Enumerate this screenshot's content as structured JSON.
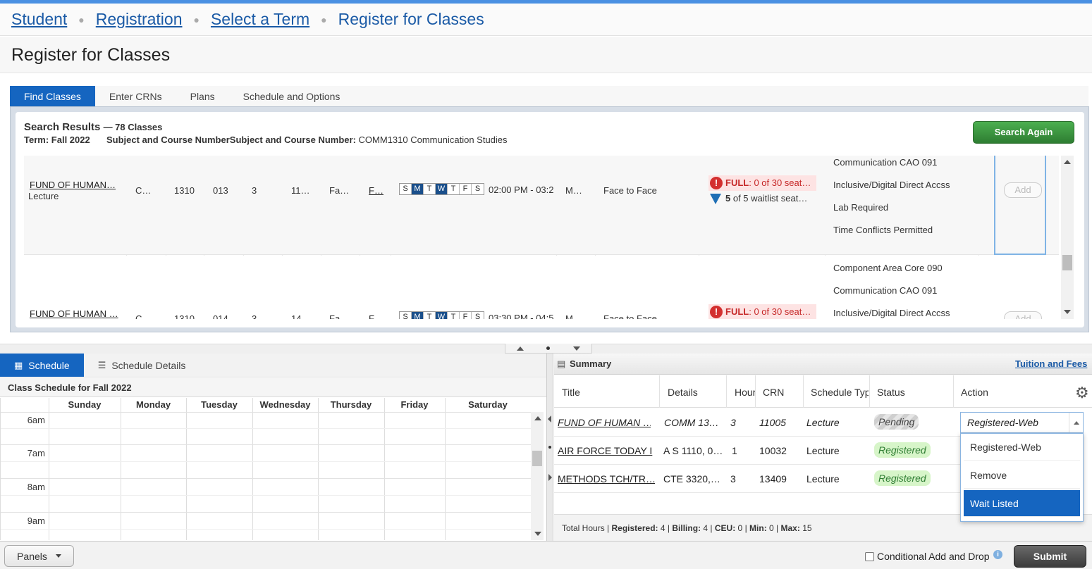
{
  "breadcrumb": {
    "items": [
      "Student",
      "Registration",
      "Select a Term"
    ],
    "current": "Register for Classes"
  },
  "page_title": "Register for Classes",
  "tabs": [
    {
      "label": "Find Classes",
      "active": true
    },
    {
      "label": "Enter CRNs",
      "active": false
    },
    {
      "label": "Plans",
      "active": false
    },
    {
      "label": "Schedule and Options",
      "active": false
    }
  ],
  "search": {
    "heading": "Search Results",
    "count_text": "— 78 Classes",
    "term_label": "Term:",
    "term_value": "Fall 2022",
    "subject_label_dup": "Subject and Course Number",
    "subject_label": "Subject and Course Number:",
    "subject_value": "COMM1310 Communication Studies",
    "search_again_label": "Search Again"
  },
  "results": [
    {
      "title": "FUND OF HUMAN…",
      "schedule_type": "Lecture",
      "subject": "C…",
      "course": "1310",
      "section": "013",
      "hours": "3",
      "crn": "11…",
      "term": "Fa…",
      "instructor": "F…",
      "days": [
        "S",
        "M",
        "T",
        "W",
        "T",
        "F",
        "S"
      ],
      "time": "02:00 PM - 03:2",
      "campus": "M…",
      "method": "Face to Face",
      "status_full": "FULL",
      "status_seats": ": 0 of 30 seat…",
      "status_waitlist_count": "5",
      "status_waitlist": " of 5 waitlist seat…",
      "attributes": [
        "Communication CAO 091",
        "Inclusive/Digital Direct Accss",
        "Lab Required",
        "Time Conflicts Permitted"
      ],
      "add_label": "Add"
    },
    {
      "title": "FUND OF HUMAN …",
      "subject": "C…",
      "course": "1310",
      "section": "014",
      "hours": "3",
      "crn": "14…",
      "term": "Fa…",
      "instructor": "F…",
      "days": [
        "S",
        "M",
        "T",
        "W",
        "T",
        "F",
        "S"
      ],
      "time": "03:30 PM - 04:5",
      "campus": "M…",
      "method": "Face to Face",
      "status_full": "FULL",
      "status_seats": ": 0 of 30 seat…",
      "attributes": [
        "Component Area Core 090",
        "Communication CAO 091",
        "Inclusive/Digital Direct Accss"
      ],
      "add_label": "Add"
    }
  ],
  "schedule": {
    "tab_schedule": "Schedule",
    "tab_details": "Schedule Details",
    "title": "Class Schedule for Fall 2022",
    "days": [
      "Sunday",
      "Monday",
      "Tuesday",
      "Wednesday",
      "Thursday",
      "Friday",
      "Saturday"
    ],
    "times": [
      "6am",
      "7am",
      "8am",
      "9am"
    ]
  },
  "summary": {
    "title": "Summary",
    "tuition_link": "Tuition and Fees",
    "columns": [
      "Title",
      "Details",
      "Hour",
      "CRN",
      "Schedule Typ",
      "Status",
      "Action"
    ],
    "rows": [
      {
        "title": "FUND OF HUMAN …",
        "details": "COMM 13…",
        "hours": "3",
        "crn": "11005",
        "type": "Lecture",
        "status": "Pending"
      },
      {
        "title": "AIR FORCE TODAY I",
        "details": "A S 1110, 0…",
        "hours": "1",
        "crn": "10032",
        "type": "Lecture",
        "status": "Registered"
      },
      {
        "title": "METHODS TCH/TR…",
        "details": "CTE 3320,…",
        "hours": "3",
        "crn": "13409",
        "type": "Lecture",
        "status": "Registered"
      }
    ],
    "action_selected": "Registered-Web",
    "action_options": [
      "Registered-Web",
      "Remove",
      "Wait Listed"
    ],
    "footer": {
      "label": "Total Hours |",
      "registered_label": "Registered:",
      "registered": "4",
      "billing_label": "Billing:",
      "billing": "4",
      "ceu_label": "CEU:",
      "ceu": "0",
      "min_label": "Min:",
      "min": "0",
      "max_label": "Max:",
      "max": "15"
    }
  },
  "footer": {
    "panels_label": "Panels",
    "conditional_label": "Conditional Add and Drop",
    "submit_label": "Submit"
  },
  "colors": {
    "accent": "#1565c0",
    "success": "#2e7d32",
    "error": "#c62828"
  }
}
